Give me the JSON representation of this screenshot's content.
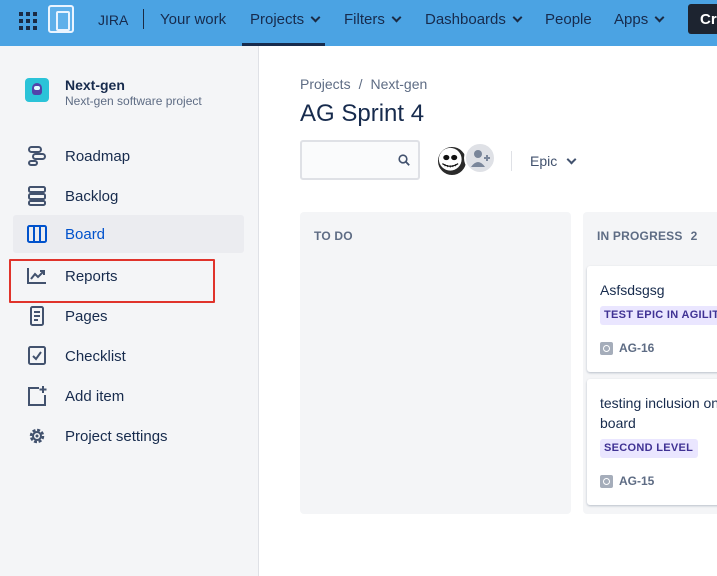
{
  "topnav": {
    "brand": "JIRA",
    "items": [
      {
        "label": "Your work"
      },
      {
        "label": "Projects"
      },
      {
        "label": "Filters"
      },
      {
        "label": "Dashboards"
      },
      {
        "label": "People"
      },
      {
        "label": "Apps"
      }
    ],
    "create_label": "Create",
    "accent": "#4ba3e3"
  },
  "sidebar": {
    "project_name": "Next-gen",
    "project_type": "Next-gen software project",
    "items": [
      {
        "label": "Roadmap",
        "icon": "roadmap-icon"
      },
      {
        "label": "Backlog",
        "icon": "backlog-icon"
      },
      {
        "label": "Board",
        "icon": "board-icon",
        "active": true
      },
      {
        "label": "Reports",
        "icon": "reports-icon"
      },
      {
        "label": "Pages",
        "icon": "pages-icon"
      },
      {
        "label": "Checklist",
        "icon": "checklist-icon"
      },
      {
        "label": "Add item",
        "icon": "add-item-icon"
      },
      {
        "label": "Project settings",
        "icon": "gear-icon"
      }
    ],
    "highlighted_item": "Reports",
    "highlight_color": "#e0332b"
  },
  "main": {
    "breadcrumb": [
      "Projects",
      "Next-gen"
    ],
    "breadcrumb_separator": "/",
    "title": "AG Sprint 4",
    "search": {
      "value": "",
      "placeholder": ""
    },
    "epic_filter_label": "Epic",
    "columns": [
      {
        "title": "TO DO",
        "count": "",
        "cards": []
      },
      {
        "title": "IN PROGRESS",
        "count": "2",
        "cards": [
          {
            "summary": "Asfsdsgsg",
            "epic": "TEST EPIC IN AGILIT",
            "key": "AG-16"
          },
          {
            "summary": "testing inclusion on board",
            "epic": "SECOND LEVEL",
            "key": "AG-15"
          }
        ]
      }
    ]
  }
}
